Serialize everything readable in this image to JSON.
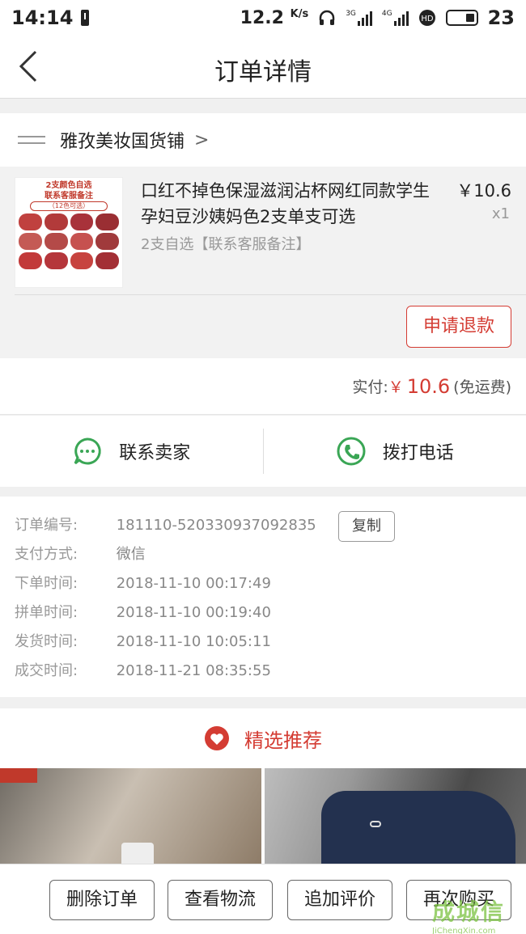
{
  "status_bar": {
    "time": "14:14",
    "speed": "12.2",
    "speed_unit": "K/s",
    "net1": "3G",
    "net2": "4G",
    "battery": "23"
  },
  "header": {
    "title": "订单详情"
  },
  "shop": {
    "name": "雅孜美妆国货铺",
    "chevron": ">"
  },
  "product": {
    "thumb_line1": "2支颜色自选",
    "thumb_line2": "联系客服备注",
    "thumb_line3": "（12色可选）",
    "title": "口红不掉色保湿滋润沾杯网红同款学生孕妇豆沙姨妈色2支单支可选",
    "spec": "2支自选【联系客服备注】",
    "price": "￥10.6",
    "qty": "x1",
    "refund_label": "申请退款",
    "lip_colors": [
      "#c0413f",
      "#b23a3a",
      "#a8323a",
      "#9a2e33",
      "#c45a55",
      "#b44a48",
      "#c6514f",
      "#a03a3c",
      "#c23a3a",
      "#b5363b",
      "#c7433f",
      "#a32f35"
    ]
  },
  "payment": {
    "label": "实付:",
    "currency": "￥",
    "amount": "10.6",
    "note": "(免运费)"
  },
  "contact": {
    "seller_label": "联系卖家",
    "phone_label": "拨打电话"
  },
  "order_info": {
    "order_no_label": "订单编号:",
    "order_no": "181110-520330937092835",
    "copy_label": "复制",
    "pay_method_label": "支付方式:",
    "pay_method": "微信",
    "order_time_label": "下单时间:",
    "order_time": "2018-11-10 00:17:49",
    "group_time_label": "拼单时间:",
    "group_time": "2018-11-10 00:19:40",
    "ship_time_label": "发货时间:",
    "ship_time": "2018-11-10 10:05:11",
    "deal_time_label": "成交时间:",
    "deal_time": "2018-11-21 08:35:55"
  },
  "recommend": {
    "title": "精选推荐"
  },
  "bottom_actions": {
    "delete": "删除订单",
    "logistics": "查看物流",
    "review": "追加评价",
    "rebuy": "再次购买"
  },
  "watermark": {
    "text": "成城信",
    "sub": "JiChengXin.com"
  },
  "colors": {
    "accent_red": "#d43c33",
    "wechat_green": "#3aa655"
  }
}
